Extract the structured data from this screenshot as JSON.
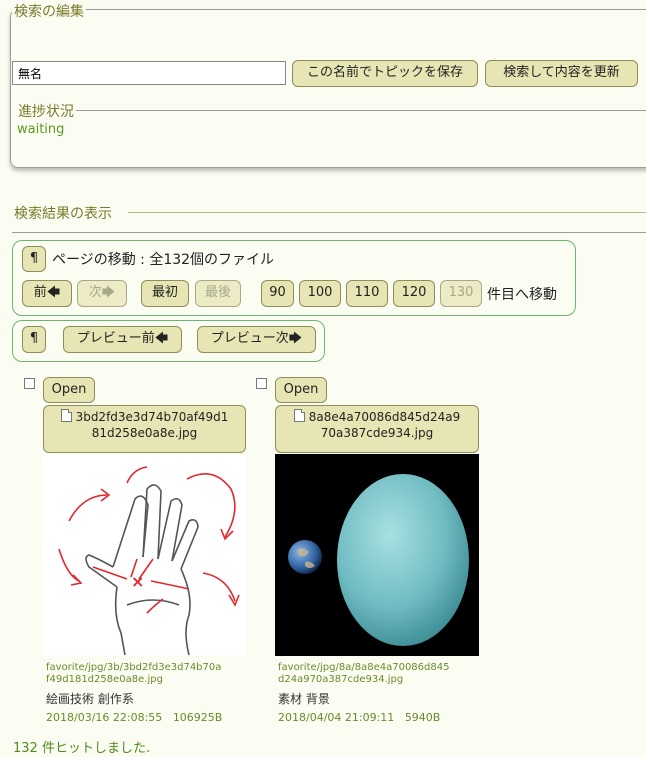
{
  "edit": {
    "title": "検索の編集",
    "name_value": "無名",
    "save_button": "この名前でトピックを保存",
    "update_button": "検索して内容を更新",
    "progress_title": "進捗状況",
    "progress_status": "waiting"
  },
  "results": {
    "title": "検索結果の表示",
    "pilcrow": "¶",
    "page_move_label": "ページの移動 : 全132個のファイル",
    "prev": "前",
    "next": "次",
    "first": "最初",
    "last": "最後",
    "pages": [
      "90",
      "100",
      "110",
      "120",
      "130"
    ],
    "goto_suffix": "件目へ移動",
    "preview_prev": "プレビュー前",
    "preview_next": "プレビュー次",
    "open_label": "Open",
    "hits": "132 件ヒットしました."
  },
  "files": [
    {
      "name_line1": "3bd2fd3e3d74b70af49d1",
      "name_line2": "81d258e0a8e.jpg",
      "path_line1": "favorite/jpg/3b/3bd2fd3e3d74b70a",
      "path_line2": "f49d181d258e0a8e.jpg",
      "tags": "絵画技術 創作系",
      "date": "2018/03/16 22:08:55",
      "size": "106925B"
    },
    {
      "name_line1": "8a8e4a70086d845d24a9",
      "name_line2": "70a387cde934.jpg",
      "path_line1": "favorite/jpg/8a/8a8e4a70086d845",
      "path_line2": "d24a970a387cde934.jpg",
      "tags": "素材 背景",
      "date": "2018/04/04 21:09:11",
      "size": "5940B"
    }
  ],
  "colors": {
    "background": "#fbfdf3",
    "button": "#e6e5b3",
    "nav_border": "#6fb46f",
    "legend_text": "#7a7a2a",
    "arrow_red": "#e0282e"
  }
}
